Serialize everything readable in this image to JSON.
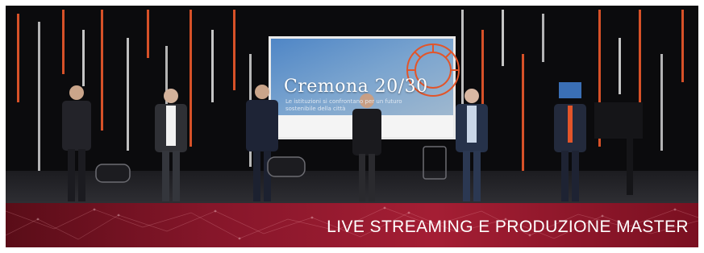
{
  "banner": {
    "title": "LIVE STREAMING E PRODUZIONE MASTER",
    "color": "#a41e34"
  },
  "screen": {
    "title": "Cremona 20/30",
    "subtitle": "Le istituzioni si confrontano per un futuro sostenibile della città"
  },
  "colors": {
    "stage_light": "#e2552a",
    "background": "#0b0b0d"
  }
}
